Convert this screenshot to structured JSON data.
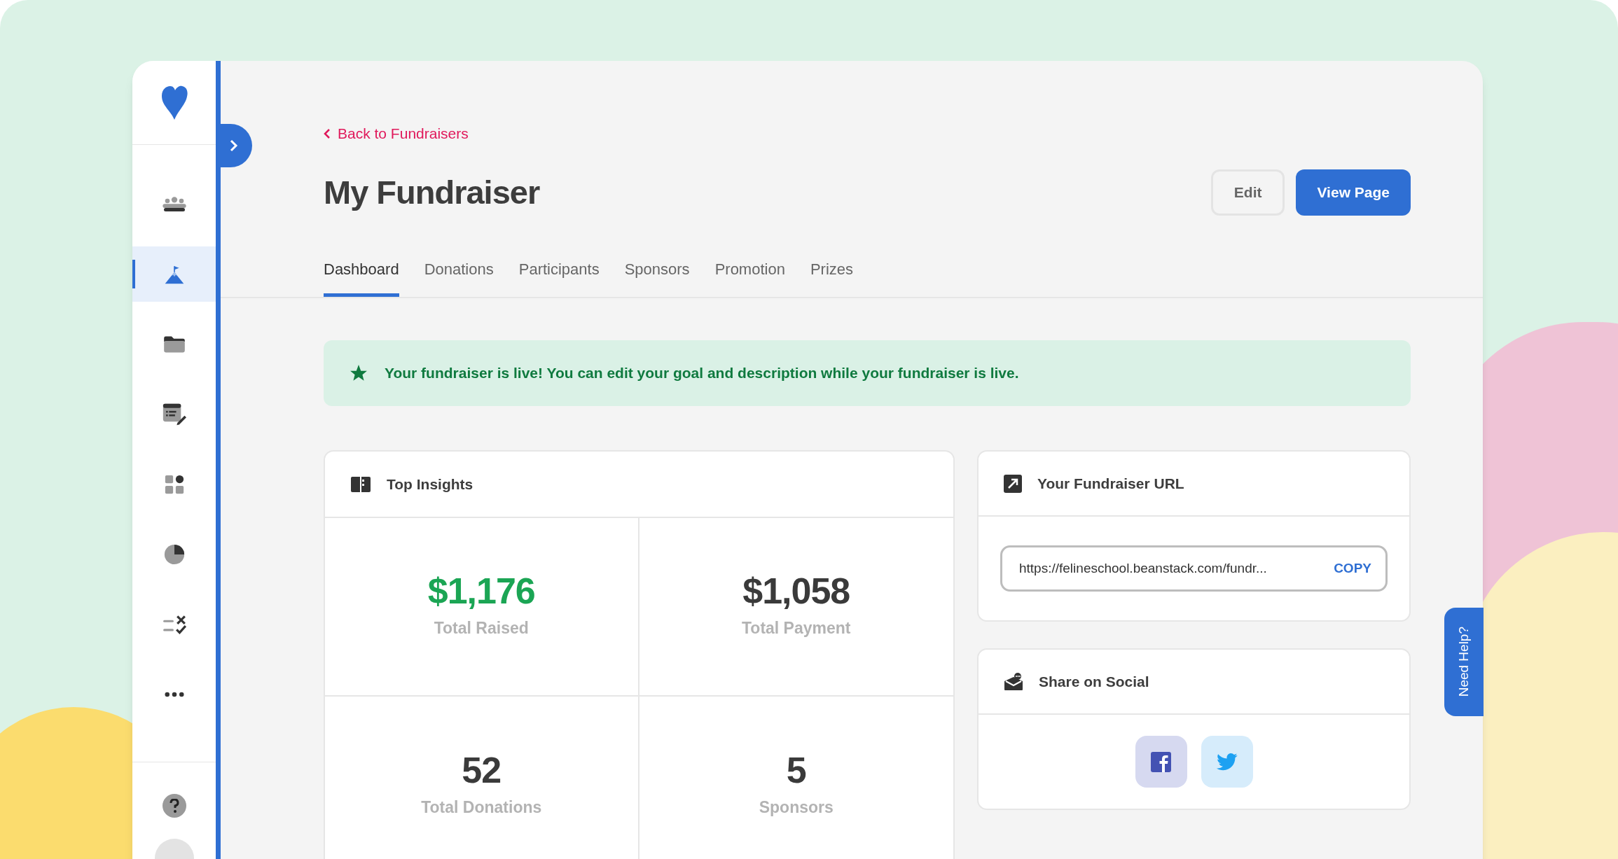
{
  "sidebar": {
    "items": [
      {
        "selected": false
      },
      {
        "selected": true
      },
      {
        "selected": false
      },
      {
        "selected": false
      },
      {
        "selected": false
      },
      {
        "selected": false
      },
      {
        "selected": false
      },
      {
        "selected": false
      }
    ]
  },
  "back_link": "Back to Fundraisers",
  "title": "My Fundraiser",
  "buttons": [
    {
      "label": "Edit",
      "kind": "secondary"
    },
    {
      "label": "View Page",
      "kind": "primary"
    }
  ],
  "tabs": [
    {
      "label": "Dashboard",
      "selected": true
    },
    {
      "label": "Donations",
      "selected": false
    },
    {
      "label": "Participants",
      "selected": false
    },
    {
      "label": "Sponsors",
      "selected": false
    },
    {
      "label": "Promotion",
      "selected": false
    },
    {
      "label": "Prizes",
      "selected": false
    }
  ],
  "banner": {
    "text": "Your fundraiser is live! You can edit your goal and description while your fundraiser is live."
  },
  "insights": {
    "title": "Top Insights",
    "stats": [
      {
        "value": "$1,176",
        "label": "Total Raised",
        "color": "#1ba554"
      },
      {
        "value": "$1,058",
        "label": "Total Payment",
        "color": "#3a3a3a"
      },
      {
        "value": "52",
        "label": "Total Donations",
        "color": "#3a3a3a"
      },
      {
        "value": "5",
        "label": "Sponsors",
        "color": "#3a3a3a"
      }
    ]
  },
  "url_card": {
    "title": "Your Fundraiser URL",
    "url": "https://felineschool.beanstack.com/fundr...",
    "action": "COPY"
  },
  "social": {
    "title": "Share on Social"
  },
  "help_tab": "Need Help?"
}
